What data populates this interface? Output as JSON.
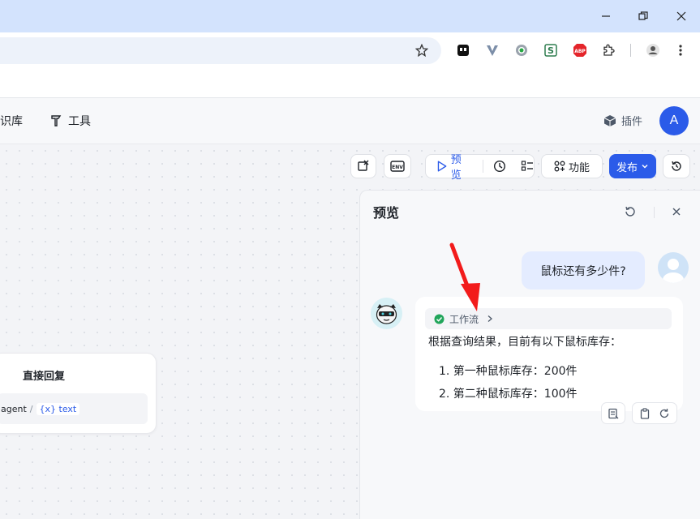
{
  "toolbar": {
    "preview_label": "预览",
    "features_label": "功能",
    "publish_label": "发布"
  },
  "header": {
    "nav_knowledge": "识库",
    "nav_tools": "工具",
    "plugins_label": "插件",
    "avatar_letter": "A"
  },
  "node": {
    "title": "直接回复",
    "var_source": "agent",
    "var_sep": "/",
    "var_name": "{x} text"
  },
  "preview": {
    "title": "预览",
    "user_message": "鼠标还有多少件?",
    "workflow_chip": "工作流",
    "answer_intro": "根据查询结果，目前有以下鼠标库存：",
    "items": [
      "1. 第一种鼠标库存：200件",
      "2. 第二种鼠标库存：100件"
    ]
  },
  "extensions": {
    "abp_label": "ABP"
  },
  "colors": {
    "accent": "#2b5be9",
    "arrow": "#f21b1b",
    "success": "#21a55b"
  }
}
